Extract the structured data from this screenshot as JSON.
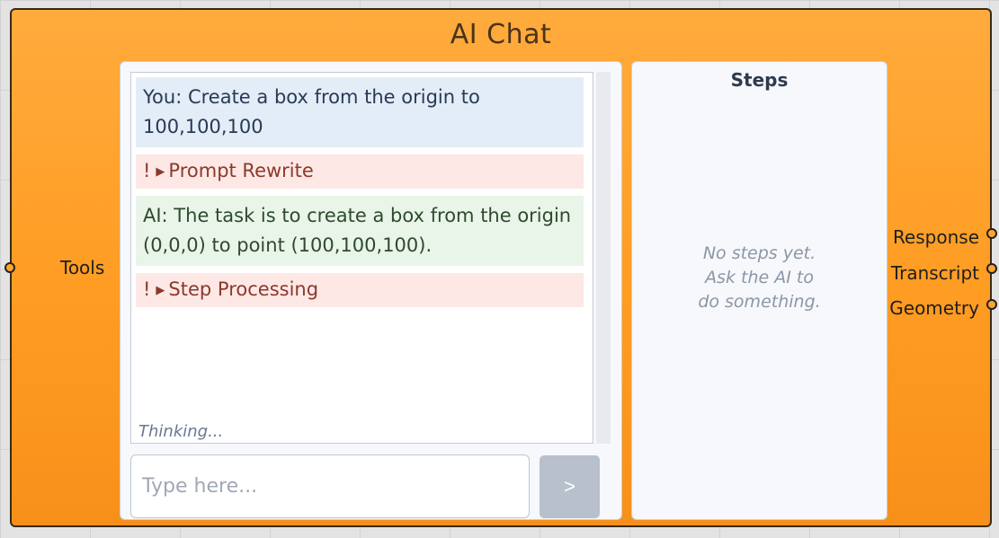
{
  "component": {
    "title": "AI Chat",
    "input_label": "Tools",
    "outputs": [
      "Response",
      "Transcript",
      "Geometry"
    ]
  },
  "chat": {
    "messages": [
      {
        "kind": "user",
        "text": "You: Create a box from the origin to 100,100,100"
      },
      {
        "kind": "step",
        "marker": "!",
        "text": "Prompt Rewrite"
      },
      {
        "kind": "ai",
        "text": "AI: The task is to create a box from the origin (0,0,0) to point (100,100,100)."
      },
      {
        "kind": "step",
        "marker": "!",
        "text": "Step Processing"
      }
    ],
    "status": "Thinking...",
    "input_placeholder": "Type here...",
    "send_label": ">"
  },
  "steps": {
    "title": "Steps",
    "empty_lines": [
      "No steps yet.",
      "Ask the AI to",
      "do something."
    ]
  },
  "colors": {
    "component_orange": "#ff9c22",
    "user_bubble": "#e3edf8",
    "ai_bubble": "#e8f5e8",
    "step_bubble": "#fde8e6"
  }
}
